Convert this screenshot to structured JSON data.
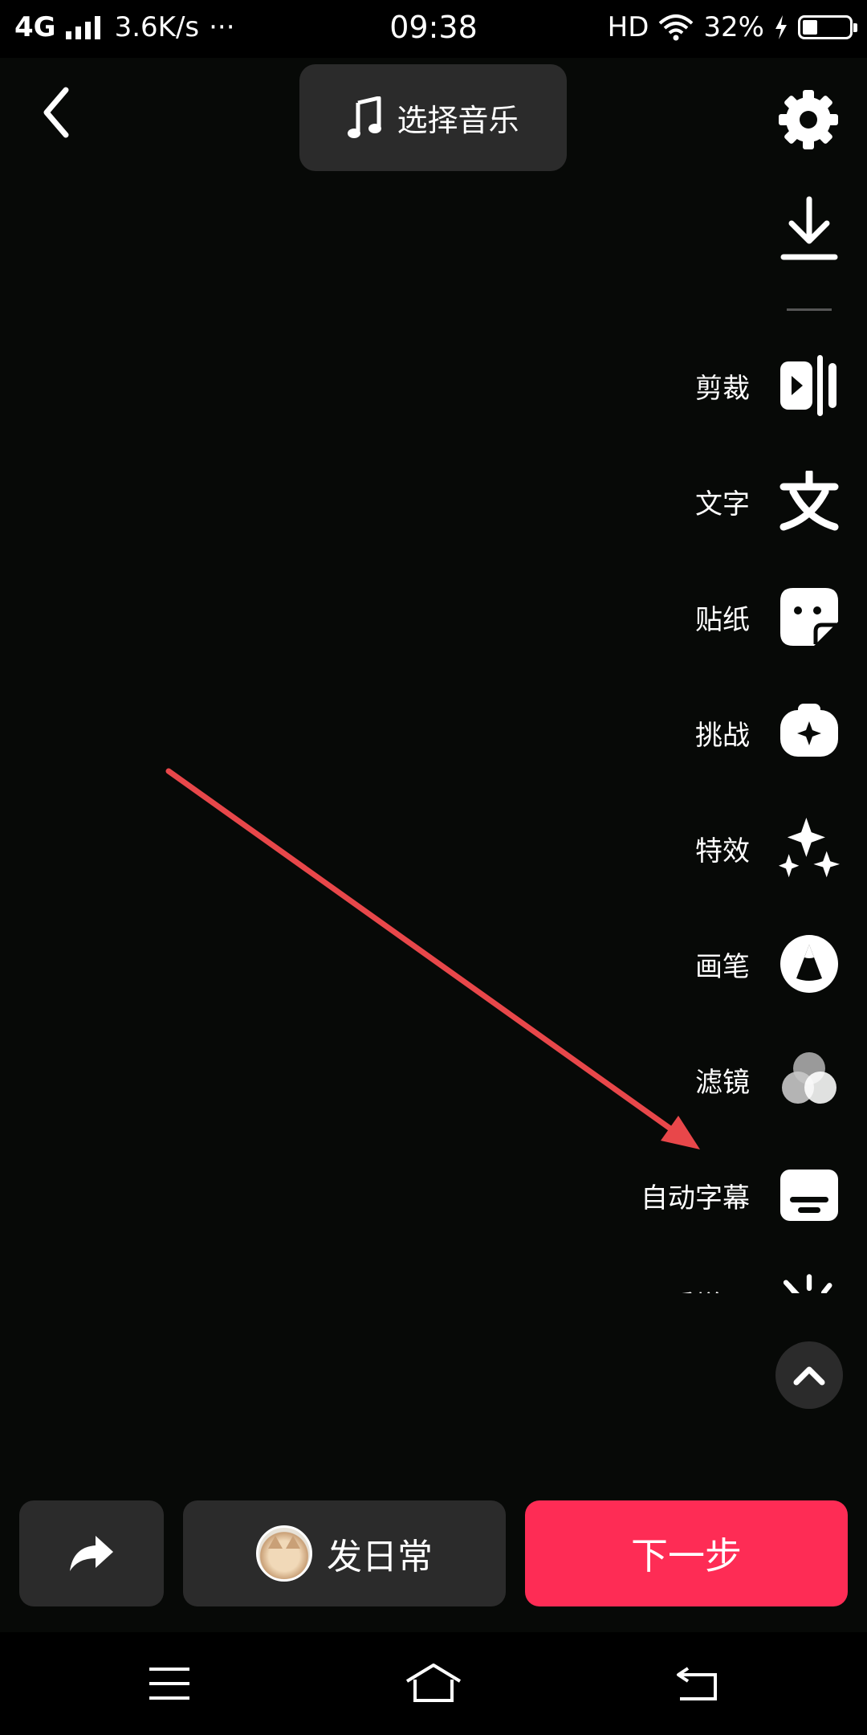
{
  "status_bar": {
    "network": "4G",
    "speed": "3.6K/s",
    "more": "···",
    "time": "09:38",
    "hd": "HD",
    "battery": "32%",
    "battery_level": 0.32,
    "icons": [
      "signal-icon",
      "wifi-icon",
      "charging-icon",
      "battery-icon"
    ]
  },
  "header": {
    "music_label": "选择音乐",
    "icons": [
      "back-icon",
      "music-note-icon",
      "settings-icon",
      "download-icon"
    ]
  },
  "tools": [
    {
      "label": "剪裁",
      "icon": "trim-icon"
    },
    {
      "label": "文字",
      "icon": "text-icon"
    },
    {
      "label": "贴纸",
      "icon": "sticker-icon"
    },
    {
      "label": "挑战",
      "icon": "challenge-icon"
    },
    {
      "label": "特效",
      "icon": "effects-icon"
    },
    {
      "label": "画笔",
      "icon": "brush-icon"
    },
    {
      "label": "滤镜",
      "icon": "filter-icon"
    },
    {
      "label": "自动字幕",
      "icon": "auto-caption-icon"
    },
    {
      "label": "画质增强",
      "icon": "enhance-icon"
    }
  ],
  "bottom": {
    "daily_label": "发日常",
    "next_label": "下一步",
    "icons": [
      "share-icon",
      "avatar"
    ]
  },
  "nav": {
    "icons": [
      "menu-icon",
      "home-icon",
      "back-nav-icon"
    ]
  },
  "colors": {
    "accent": "#fe2c55",
    "annotation_arrow": "#e8474a",
    "panel": "#2b2b2b",
    "background": "#070907"
  }
}
